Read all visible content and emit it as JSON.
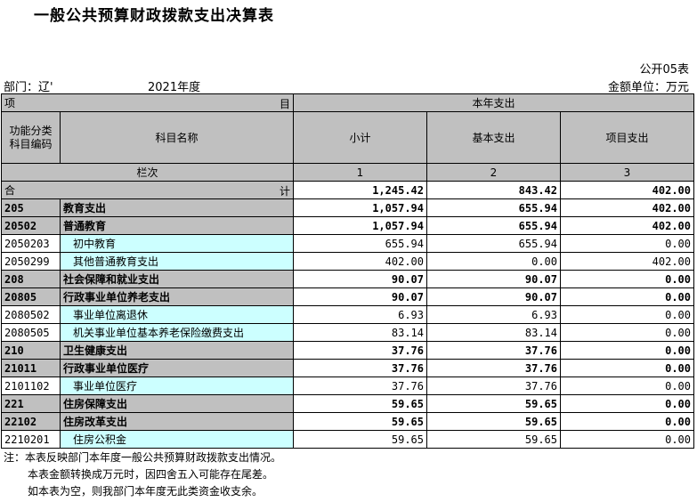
{
  "title": "一般公共预算财政拨款支出决算表",
  "form_code": "公开05表",
  "dept_label": "部门：辽'",
  "year_label": "2021年度",
  "unit_label": "金额单位：万元",
  "header": {
    "item": "项",
    "item_end": "目",
    "current_year": "本年支出",
    "func_code": "功能分类\n科目编码",
    "subject_name": "科目名称",
    "subtotal": "小计",
    "basic": "基本支出",
    "project": "项目支出",
    "col_index_label": "栏次",
    "col1": "1",
    "col2": "2",
    "col3": "3"
  },
  "total_row": {
    "left": "合",
    "right": "计",
    "subtotal": "1,245.42",
    "basic": "843.42",
    "project": "402.00"
  },
  "rows": [
    {
      "code": "205",
      "name": "教育支出",
      "subtotal": "1,057.94",
      "basic": "655.94",
      "project": "402.00",
      "level": "class"
    },
    {
      "code": "20502",
      "name": "普通教育",
      "subtotal": "1,057.94",
      "basic": "655.94",
      "project": "402.00",
      "level": "class"
    },
    {
      "code": "2050203",
      "name": "初中教育",
      "subtotal": "655.94",
      "basic": "655.94",
      "project": "0.00",
      "level": "item"
    },
    {
      "code": "2050299",
      "name": "其他普通教育支出",
      "subtotal": "402.00",
      "basic": "0.00",
      "project": "402.00",
      "level": "item"
    },
    {
      "code": "208",
      "name": "社会保障和就业支出",
      "subtotal": "90.07",
      "basic": "90.07",
      "project": "0.00",
      "level": "class"
    },
    {
      "code": "20805",
      "name": "行政事业单位养老支出",
      "subtotal": "90.07",
      "basic": "90.07",
      "project": "0.00",
      "level": "class"
    },
    {
      "code": "2080502",
      "name": "事业单位离退休",
      "subtotal": "6.93",
      "basic": "6.93",
      "project": "0.00",
      "level": "item"
    },
    {
      "code": "2080505",
      "name": "机关事业单位基本养老保险缴费支出",
      "subtotal": "83.14",
      "basic": "83.14",
      "project": "0.00",
      "level": "item"
    },
    {
      "code": "210",
      "name": "卫生健康支出",
      "subtotal": "37.76",
      "basic": "37.76",
      "project": "0.00",
      "level": "class"
    },
    {
      "code": "21011",
      "name": "行政事业单位医疗",
      "subtotal": "37.76",
      "basic": "37.76",
      "project": "0.00",
      "level": "class"
    },
    {
      "code": "2101102",
      "name": "事业单位医疗",
      "subtotal": "37.76",
      "basic": "37.76",
      "project": "0.00",
      "level": "item"
    },
    {
      "code": "221",
      "name": "住房保障支出",
      "subtotal": "59.65",
      "basic": "59.65",
      "project": "0.00",
      "level": "class"
    },
    {
      "code": "22102",
      "name": "住房改革支出",
      "subtotal": "59.65",
      "basic": "59.65",
      "project": "0.00",
      "level": "class"
    },
    {
      "code": "2210201",
      "name": "住房公积金",
      "subtotal": "59.65",
      "basic": "59.65",
      "project": "0.00",
      "level": "item"
    }
  ],
  "notes": [
    "注：本表反映部门本年度一般公共预算财政拨款支出情况。",
    "本表金额转换成万元时，因四舍五入可能存在尾差。",
    "如本表为空，则我部门本年度无此类资金收支余。"
  ]
}
